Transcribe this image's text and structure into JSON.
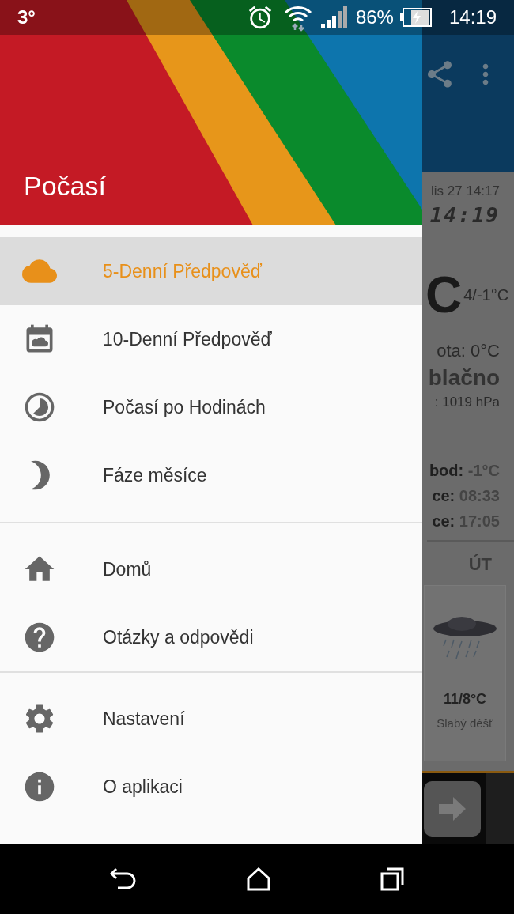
{
  "status_bar": {
    "temperature": "3°",
    "battery": "86%",
    "time": "14:19"
  },
  "drawer": {
    "title": "Počasí",
    "sections": [
      {
        "items": [
          {
            "label": "5-Denní Předpověď",
            "selected": true
          },
          {
            "label": "10-Denní Předpověď",
            "selected": false
          },
          {
            "label": "Počasí po Hodinách",
            "selected": false
          },
          {
            "label": "Fáze měsíce",
            "selected": false
          }
        ]
      },
      {
        "items": [
          {
            "label": "Domů",
            "selected": false
          },
          {
            "label": "Otázky a odpovědi",
            "selected": false
          }
        ]
      },
      {
        "items": [
          {
            "label": "Nastavení",
            "selected": false
          },
          {
            "label": "O aplikaci",
            "selected": false
          }
        ]
      }
    ]
  },
  "background_app": {
    "updated": "lis 27  14:17",
    "clock": "14:19",
    "temperature": "C",
    "high_low": "4/-1°C",
    "feels_like": "ota: 0°C",
    "condition": "blačno",
    "pressure": ": 1019 hPa",
    "details": [
      {
        "label": "bod:",
        "value": "-1°C"
      },
      {
        "label": "ce:",
        "value": "08:33"
      },
      {
        "label": "ce:",
        "value": "17:05"
      }
    ],
    "forecast": {
      "day": "ÚT",
      "temperature": "11/8°C",
      "condition": "Slabý déšť"
    }
  }
}
